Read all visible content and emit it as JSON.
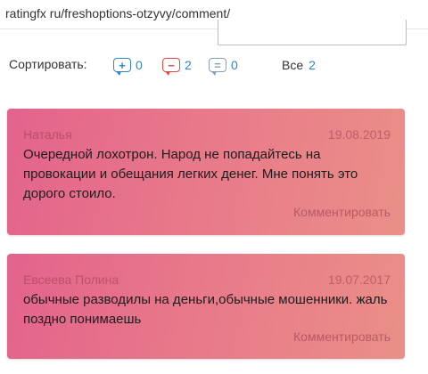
{
  "browser": {
    "url": "ratingfx ru/freshoptions-otzyvy/comment/"
  },
  "sort": {
    "label": "Сортировать:",
    "positive": {
      "icon": "plus-comment-icon",
      "count": "0"
    },
    "negative": {
      "icon": "minus-comment-icon",
      "count": "2"
    },
    "neutral": {
      "icon": "neutral-comment-icon",
      "count": "0"
    },
    "all": {
      "label": "Все",
      "count": "2"
    }
  },
  "colors": {
    "accent_blue": "#2f86c8",
    "negative_red": "#e8483f",
    "card_gradient_start": "#e3638c",
    "card_gradient_end": "#ea8f88"
  },
  "comments": [
    {
      "author": "Наталья",
      "date": "19.08.2019",
      "text": "Очередной лохотрон. Народ не попадайтесь на провокации и обещания легких денег. Мне понять это дорого стоило.",
      "reply_label": "Комментировать"
    },
    {
      "author": "Евсеева Полина",
      "date": "19.07.2017",
      "text": "обычные разводилы на деньги,обычные мошенники. жаль поздно понимаешь",
      "reply_label": "Комментировать"
    }
  ]
}
